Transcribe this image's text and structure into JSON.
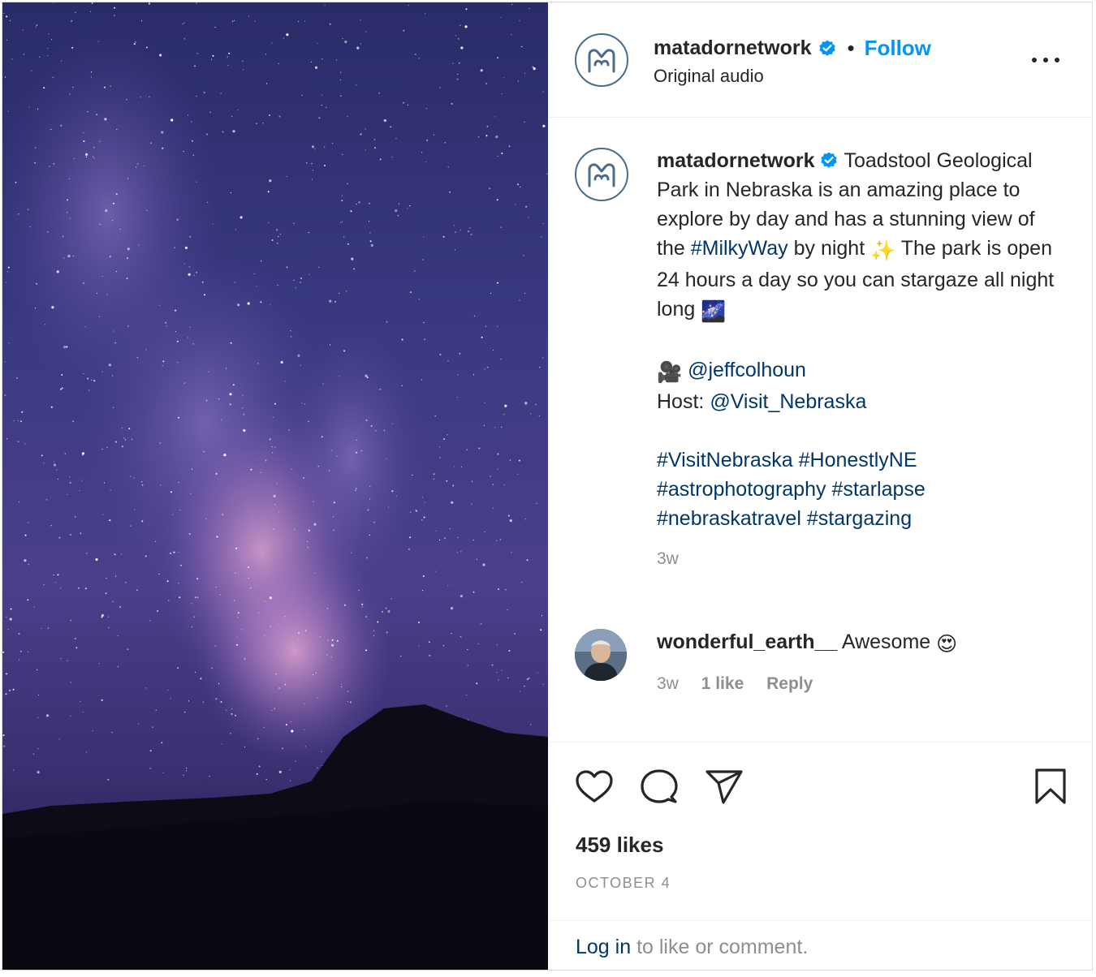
{
  "post": {
    "username": "matadornetwork",
    "follow_label": "Follow",
    "separator": "•",
    "audio": "Original audio"
  },
  "caption": {
    "username": "matadornetwork",
    "text_1": "Toadstool Geological Park in Nebraska is an amazing place to explore by day and has a stunning view of the",
    "hashtag_milkyway": "#MilkyWay",
    "text_2": "by night",
    "emoji_sparkles": "✨",
    "text_3": "The park is open 24 hours a day so you can stargaze all night long",
    "emoji_milky_way": "🌌",
    "emoji_camera": "🎥",
    "credit_mention": "@jeffcolhoun",
    "host_label": "Host:",
    "host_mention": "@Visit_Nebraska",
    "hashtags": [
      "#VisitNebraska",
      "#HonestlyNE",
      "#astrophotography",
      "#starlapse",
      "#nebraskatravel",
      "#stargazing"
    ],
    "timestamp": "3w"
  },
  "comment": {
    "username": "wonderful_earth__",
    "text": "Awesome",
    "emoji": "😍",
    "timestamp": "3w",
    "likes": "1 like",
    "reply_label": "Reply"
  },
  "stats": {
    "likes": "459 likes",
    "date": "OCTOBER 4"
  },
  "footer": {
    "login_link": "Log in",
    "login_rest": "to like or comment."
  },
  "icons": {
    "like": "heart-icon",
    "comment": "comment-bubble-icon",
    "share": "paper-plane-icon",
    "save": "bookmark-icon",
    "more": "more-options-icon",
    "verified": "verified-badge-icon"
  },
  "colors": {
    "follow": "#0095f6",
    "link": "#00376b",
    "verified": "#0095f6",
    "muted": "#8e8e8e",
    "text": "#262626"
  }
}
